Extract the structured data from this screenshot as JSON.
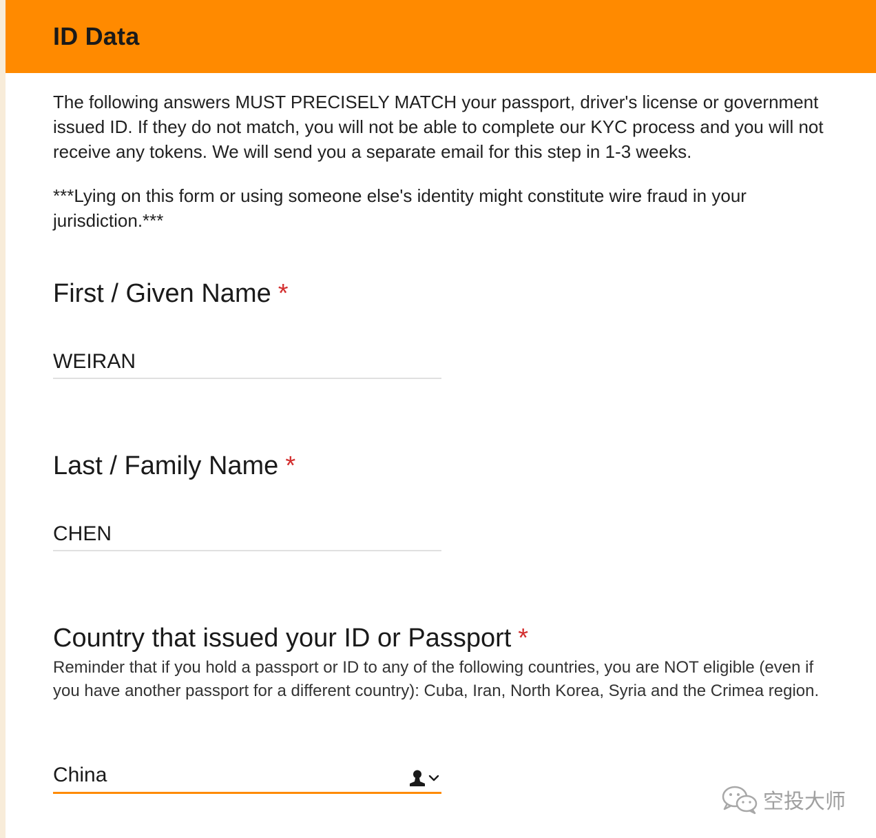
{
  "header": {
    "title": "ID Data"
  },
  "intro": {
    "text": "The following answers MUST PRECISELY MATCH your passport, driver's license or government issued ID. If they do not match, you will not be able to complete our KYC process and you will not receive any tokens. We will send you a separate email for this step in 1-3 weeks.",
    "warning": "***Lying on this form or using someone else's identity might constitute wire fraud in your jurisdiction.***"
  },
  "fields": {
    "first_name": {
      "label": "First / Given Name",
      "required_mark": "*",
      "value": "WEIRAN"
    },
    "last_name": {
      "label": "Last / Family Name",
      "required_mark": "*",
      "value": "CHEN"
    },
    "country": {
      "label": "Country that issued your ID or Passport",
      "required_mark": "*",
      "help": "Reminder that if you hold a passport or ID to any of the following countries, you are NOT eligible (even if you have another passport for a different country): Cuba, Iran, North Korea, Syria and the Crimea region.",
      "selected": "China"
    }
  },
  "watermark": {
    "text": "空投大师"
  },
  "colors": {
    "accent": "#ff8a00",
    "required": "#d32f2f",
    "underline": "#e0e0e0",
    "side_strip": "#f8ecd9"
  },
  "icons": {
    "select_contact": "person-icon",
    "select_dropdown": "chevron-down-icon",
    "watermark_logo": "wechat-logo-icon"
  }
}
